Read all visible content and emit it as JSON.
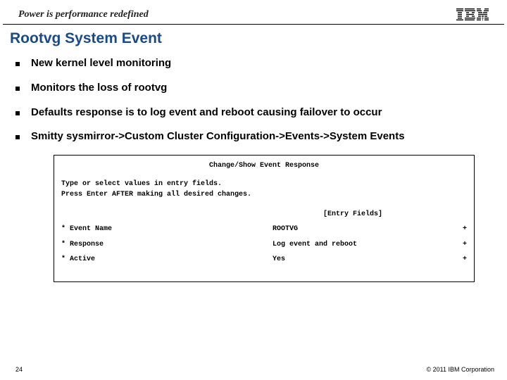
{
  "header": {
    "tagline": "Power is performance redefined",
    "logo_name": "ibm-logo"
  },
  "title": "Rootvg System Event",
  "bullets": [
    "New kernel level monitoring",
    "Monitors the loss of rootvg",
    "Defaults response is to log event and reboot causing failover to occur",
    "Smitty sysmirror->Custom Cluster Configuration->Events->System Events"
  ],
  "panel": {
    "title": "Change/Show Event Response",
    "instruction1": "Type or select values in entry fields.",
    "instruction2": "Press Enter AFTER making all desired changes.",
    "entry_fields_label": "[Entry Fields]",
    "rows": [
      {
        "label": "* Event Name",
        "value": "ROOTVG",
        "plus": "+"
      },
      {
        "label": "* Response",
        "value": "Log event and reboot",
        "plus": "+"
      },
      {
        "label": "* Active",
        "value": "Yes",
        "plus": "+"
      }
    ]
  },
  "footer": {
    "page": "24",
    "copyright": "© 2011 IBM Corporation"
  }
}
